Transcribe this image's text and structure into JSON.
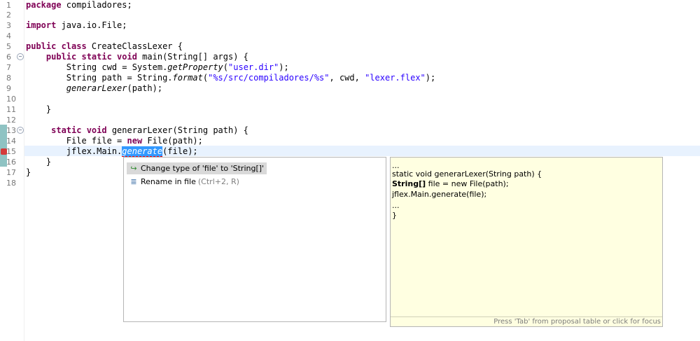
{
  "editor": {
    "line_numbers": [
      "1",
      "2",
      "3",
      "4",
      "5",
      "6",
      "7",
      "8",
      "9",
      "10",
      "11",
      "12",
      "13",
      "14",
      "15",
      "16",
      "17",
      "18"
    ],
    "code": {
      "l1_kw": "package",
      "l1_rest": " compiladores;",
      "l3_kw": "import",
      "l3_rest": " java.io.File;",
      "l5_kw": "public class",
      "l5_rest": " CreateClassLexer {",
      "l6_indent": "    ",
      "l6_kw": "public static void",
      "l6_rest": " main(String[] args) {",
      "l7_a": "        String cwd = System.",
      "l7_method": "getProperty",
      "l7_b": "(",
      "l7_str": "\"user.dir\"",
      "l7_c": ");",
      "l8_a": "        String path = String.",
      "l8_method": "format",
      "l8_b": "(",
      "l8_str1": "\"%s/src/compiladores/%s\"",
      "l8_c": ", cwd, ",
      "l8_str2": "\"lexer.flex\"",
      "l8_d": ");",
      "l9_indent": "        ",
      "l9_method": "generarLexer",
      "l9_rest": "(path);",
      "l11": "    }",
      "l13_indent": "     ",
      "l13_kw": "static void",
      "l13_rest": " generarLexer(String path) {",
      "l14_a": "        File file = ",
      "l14_kw": "new",
      "l14_rest": " File(path);",
      "l15_a": "        jflex.Main.",
      "l15_sel": "generate",
      "l15_rest": "(file);",
      "l16": "    }",
      "l17": "}"
    }
  },
  "proposals": {
    "items": [
      {
        "label": "Change type of 'file' to 'String[]'",
        "hint": "",
        "icon": "quickfix-icon"
      },
      {
        "label": "Rename in file",
        "hint": "(Ctrl+2, R)",
        "icon": "rename-icon"
      }
    ]
  },
  "preview": {
    "lines": {
      "p1": "...",
      "p2": "static void generarLexer(String path) {",
      "p3_bold": "String[]",
      "p3_rest": " file = new File(path);",
      "p4": "jflex.Main.generate(file);",
      "p5": "...",
      "p6": "}"
    },
    "status": "Press 'Tab' from proposal table or click for focus"
  },
  "colors": {
    "keyword": "#7f0055",
    "string": "#2a00ff",
    "selection": "#3399ff",
    "preview_bg": "#ffffe1",
    "current_line": "#e8f2fe"
  }
}
